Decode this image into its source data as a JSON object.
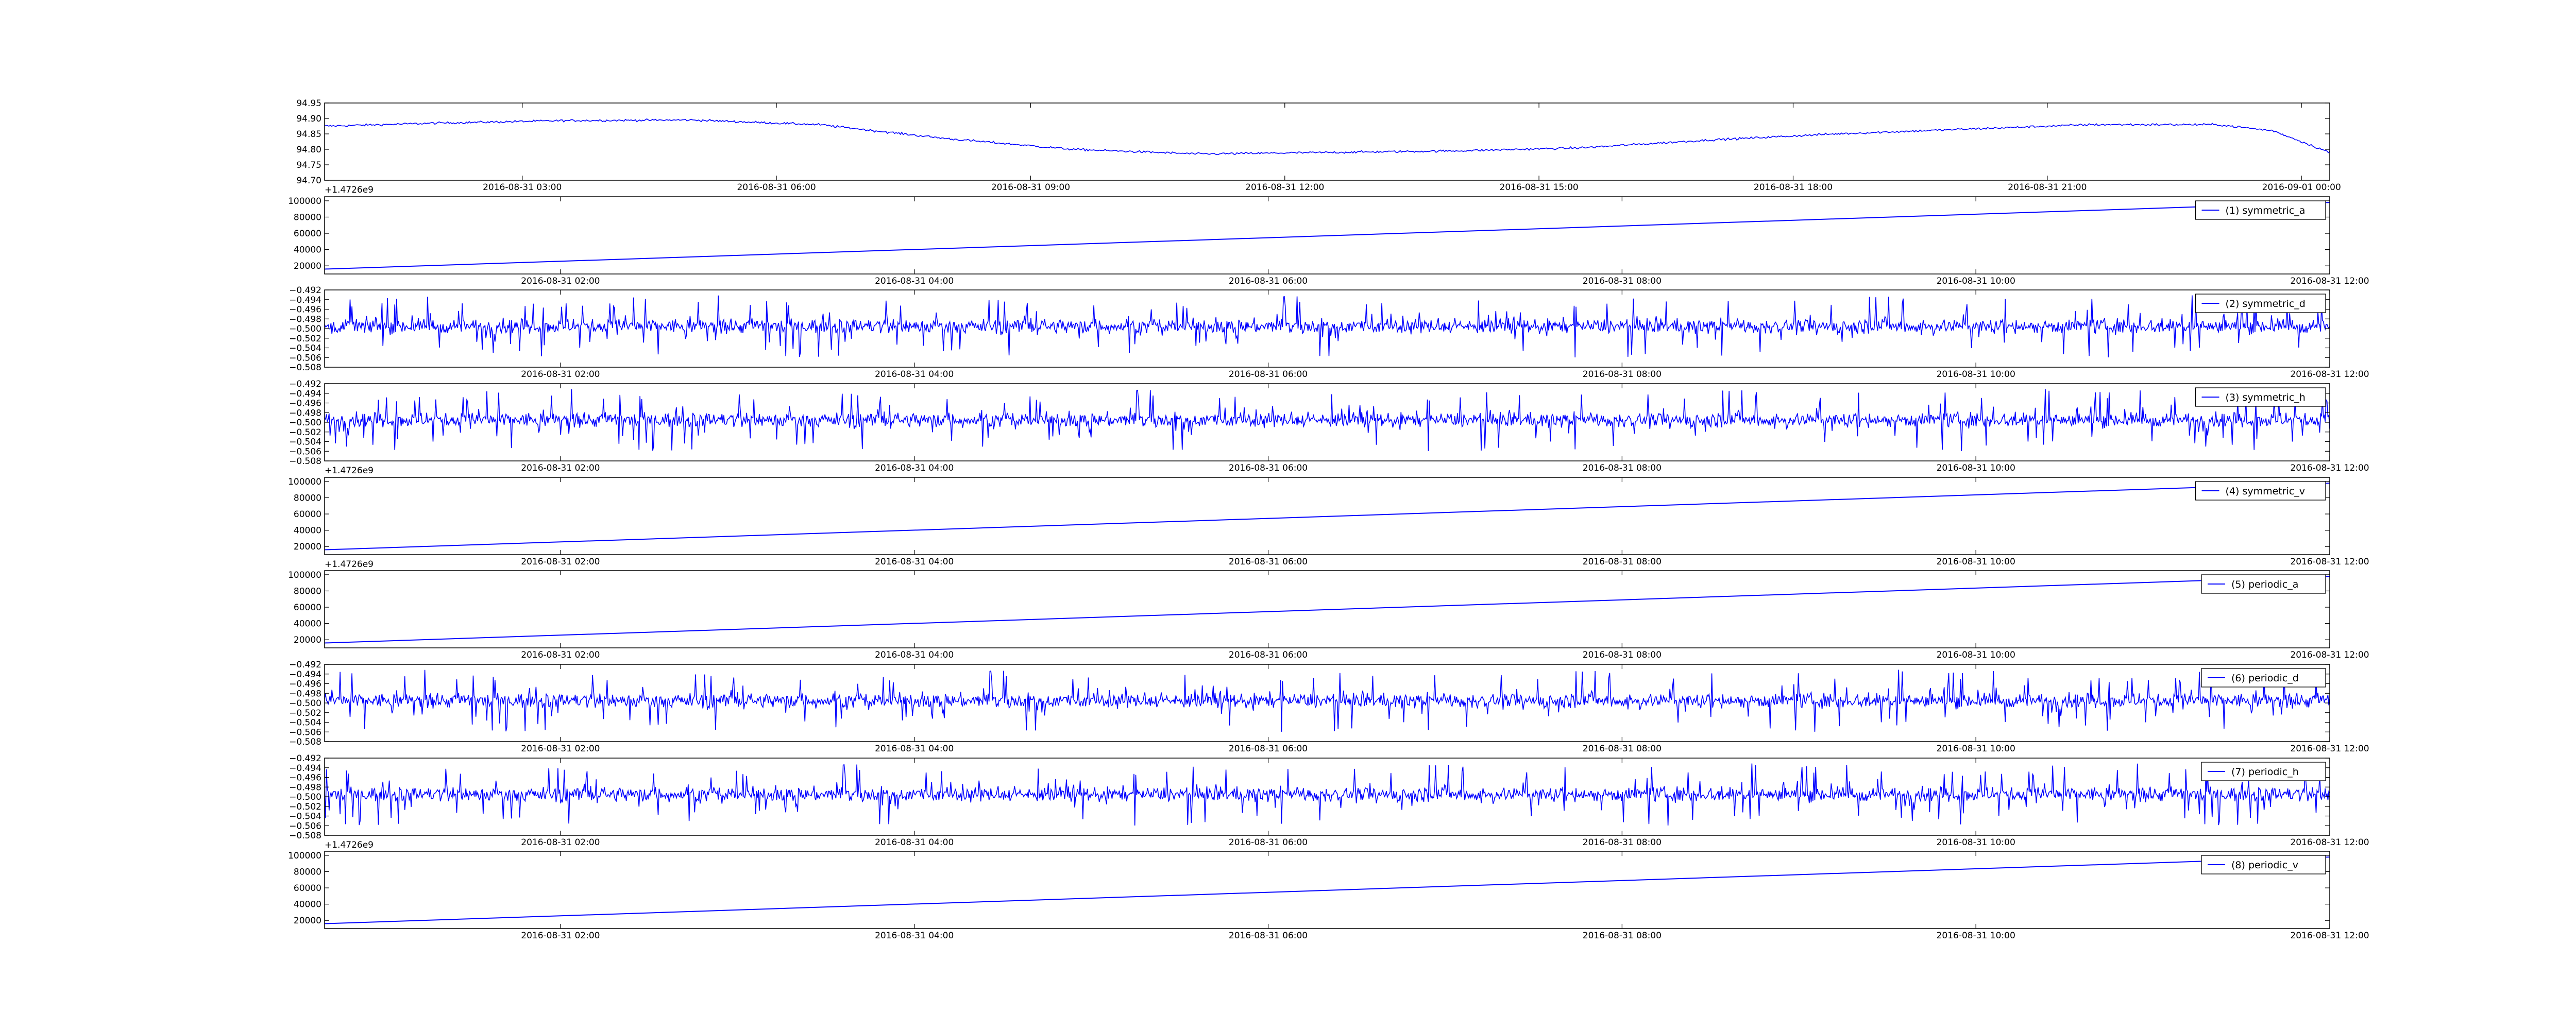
{
  "style": {
    "line_color": "#0000ff",
    "axes_color": "#000000",
    "background": "#ffffff"
  },
  "chart_data": [
    {
      "id": "top",
      "type": "line",
      "signal": "wander",
      "x_range": [
        "2016-08-31 00:40",
        "2016-09-01 00:20"
      ],
      "ylim": [
        94.7,
        94.95
      ],
      "yticks": [
        "94.70",
        "94.75",
        "94.80",
        "94.85",
        "94.90",
        "94.95"
      ],
      "xticks": [
        {
          "at": "2016-08-31 03:00",
          "label": "2016-08-31 03:00"
        },
        {
          "at": "2016-08-31 06:00",
          "label": "2016-08-31 06:00"
        },
        {
          "at": "2016-08-31 09:00",
          "label": "2016-08-31 09:00"
        },
        {
          "at": "2016-08-31 12:00",
          "label": "2016-08-31 12:00"
        },
        {
          "at": "2016-08-31 15:00",
          "label": "2016-08-31 15:00"
        },
        {
          "at": "2016-08-31 18:00",
          "label": "2016-08-31 18:00"
        },
        {
          "at": "2016-08-31 21:00",
          "label": "2016-08-31 21:00"
        },
        {
          "at": "2016-09-01 00:00",
          "label": "2016-09-01 00:00"
        }
      ],
      "offset_label": "+1.4726e9",
      "trend": [
        {
          "x": "2016-08-31 00:40",
          "y": 94.875
        },
        {
          "x": "2016-08-31 02:00",
          "y": 94.885
        },
        {
          "x": "2016-08-31 03:30",
          "y": 94.893
        },
        {
          "x": "2016-08-31 05:00",
          "y": 94.895
        },
        {
          "x": "2016-08-31 06:30",
          "y": 94.88
        },
        {
          "x": "2016-08-31 08:00",
          "y": 94.835
        },
        {
          "x": "2016-08-31 09:30",
          "y": 94.8
        },
        {
          "x": "2016-08-31 11:00",
          "y": 94.785
        },
        {
          "x": "2016-08-31 12:30",
          "y": 94.79
        },
        {
          "x": "2016-08-31 14:00",
          "y": 94.795
        },
        {
          "x": "2016-08-31 15:30",
          "y": 94.805
        },
        {
          "x": "2016-08-31 17:00",
          "y": 94.83
        },
        {
          "x": "2016-08-31 18:30",
          "y": 94.85
        },
        {
          "x": "2016-08-31 20:00",
          "y": 94.865
        },
        {
          "x": "2016-08-31 21:30",
          "y": 94.88
        },
        {
          "x": "2016-08-31 23:00",
          "y": 94.88
        },
        {
          "x": "2016-08-31 23:40",
          "y": 94.86
        },
        {
          "x": "2016-09-01 00:20",
          "y": 94.79
        }
      ]
    },
    {
      "id": "symmetric_a",
      "type": "line",
      "signal": "linear",
      "legend": "(1) symmetric_a",
      "x_range": [
        "2016-08-31 00:40",
        "2016-08-31 12:00"
      ],
      "ylim": [
        10000,
        105000
      ],
      "yticks": [
        "20000",
        "40000",
        "60000",
        "80000",
        "100000"
      ],
      "xticks": [
        {
          "at": "2016-08-31 02:00",
          "label": "2016-08-31 02:00"
        },
        {
          "at": "2016-08-31 04:00",
          "label": "2016-08-31 04:00"
        },
        {
          "at": "2016-08-31 06:00",
          "label": "2016-08-31 06:00"
        },
        {
          "at": "2016-08-31 08:00",
          "label": "2016-08-31 08:00"
        },
        {
          "at": "2016-08-31 10:00",
          "label": "2016-08-31 10:00"
        },
        {
          "at": "2016-08-31 12:00",
          "label": "2016-08-31 12:00"
        }
      ],
      "offset_label": "",
      "trend": [
        {
          "x": "2016-08-31 00:40",
          "y": 16000
        },
        {
          "x": "2016-08-31 12:00",
          "y": 98000
        }
      ]
    },
    {
      "id": "symmetric_d",
      "type": "line",
      "signal": "noise",
      "legend": "(2) symmetric_d",
      "x_range": [
        "2016-08-31 00:40",
        "2016-08-31 12:00"
      ],
      "ylim": [
        -0.508,
        -0.492
      ],
      "yticks": [
        "−0.508",
        "−0.506",
        "−0.504",
        "−0.502",
        "−0.500",
        "−0.498",
        "−0.496",
        "−0.494",
        "−0.492"
      ],
      "xticks": [
        {
          "at": "2016-08-31 02:00",
          "label": "2016-08-31 02:00"
        },
        {
          "at": "2016-08-31 04:00",
          "label": "2016-08-31 04:00"
        },
        {
          "at": "2016-08-31 06:00",
          "label": "2016-08-31 06:00"
        },
        {
          "at": "2016-08-31 08:00",
          "label": "2016-08-31 08:00"
        },
        {
          "at": "2016-08-31 10:00",
          "label": "2016-08-31 10:00"
        },
        {
          "at": "2016-08-31 12:00",
          "label": "2016-08-31 12:00"
        }
      ],
      "offset_label": "",
      "center": -0.4995,
      "amplitude": 0.0065
    },
    {
      "id": "symmetric_h",
      "type": "line",
      "signal": "noise",
      "legend": "(3) symmetric_h",
      "x_range": [
        "2016-08-31 00:40",
        "2016-08-31 12:00"
      ],
      "ylim": [
        -0.508,
        -0.492
      ],
      "yticks": [
        "−0.508",
        "−0.506",
        "−0.504",
        "−0.502",
        "−0.500",
        "−0.498",
        "−0.496",
        "−0.494",
        "−0.492"
      ],
      "xticks": [
        {
          "at": "2016-08-31 02:00",
          "label": "2016-08-31 02:00"
        },
        {
          "at": "2016-08-31 04:00",
          "label": "2016-08-31 04:00"
        },
        {
          "at": "2016-08-31 06:00",
          "label": "2016-08-31 06:00"
        },
        {
          "at": "2016-08-31 08:00",
          "label": "2016-08-31 08:00"
        },
        {
          "at": "2016-08-31 10:00",
          "label": "2016-08-31 10:00"
        },
        {
          "at": "2016-08-31 12:00",
          "label": "2016-08-31 12:00"
        }
      ],
      "offset_label": "+1.4726e9",
      "center": -0.4995,
      "amplitude": 0.0065
    },
    {
      "id": "symmetric_v",
      "type": "line",
      "signal": "linear",
      "legend": "(4) symmetric_v",
      "x_range": [
        "2016-08-31 00:40",
        "2016-08-31 12:00"
      ],
      "ylim": [
        10000,
        105000
      ],
      "yticks": [
        "20000",
        "40000",
        "60000",
        "80000",
        "100000"
      ],
      "xticks": [
        {
          "at": "2016-08-31 02:00",
          "label": "2016-08-31 02:00"
        },
        {
          "at": "2016-08-31 04:00",
          "label": "2016-08-31 04:00"
        },
        {
          "at": "2016-08-31 06:00",
          "label": "2016-08-31 06:00"
        },
        {
          "at": "2016-08-31 08:00",
          "label": "2016-08-31 08:00"
        },
        {
          "at": "2016-08-31 10:00",
          "label": "2016-08-31 10:00"
        },
        {
          "at": "2016-08-31 12:00",
          "label": "2016-08-31 12:00"
        }
      ],
      "offset_label": "+1.4726e9",
      "trend": [
        {
          "x": "2016-08-31 00:40",
          "y": 16000
        },
        {
          "x": "2016-08-31 12:00",
          "y": 98000
        }
      ]
    },
    {
      "id": "periodic_a",
      "type": "line",
      "signal": "linear",
      "legend": "(5) periodic_a",
      "x_range": [
        "2016-08-31 00:40",
        "2016-08-31 12:00"
      ],
      "ylim": [
        10000,
        105000
      ],
      "yticks": [
        "20000",
        "40000",
        "60000",
        "80000",
        "100000"
      ],
      "xticks": [
        {
          "at": "2016-08-31 02:00",
          "label": "2016-08-31 02:00"
        },
        {
          "at": "2016-08-31 04:00",
          "label": "2016-08-31 04:00"
        },
        {
          "at": "2016-08-31 06:00",
          "label": "2016-08-31 06:00"
        },
        {
          "at": "2016-08-31 08:00",
          "label": "2016-08-31 08:00"
        },
        {
          "at": "2016-08-31 10:00",
          "label": "2016-08-31 10:00"
        },
        {
          "at": "2016-08-31 12:00",
          "label": "2016-08-31 12:00"
        }
      ],
      "offset_label": "",
      "trend": [
        {
          "x": "2016-08-31 00:40",
          "y": 16000
        },
        {
          "x": "2016-08-31 12:00",
          "y": 98000
        }
      ]
    },
    {
      "id": "periodic_d",
      "type": "line",
      "signal": "noise",
      "legend": "(6) periodic_d",
      "x_range": [
        "2016-08-31 00:40",
        "2016-08-31 12:00"
      ],
      "ylim": [
        -0.508,
        -0.492
      ],
      "yticks": [
        "−0.508",
        "−0.506",
        "−0.504",
        "−0.502",
        "−0.500",
        "−0.498",
        "−0.496",
        "−0.494",
        "−0.492"
      ],
      "xticks": [
        {
          "at": "2016-08-31 02:00",
          "label": "2016-08-31 02:00"
        },
        {
          "at": "2016-08-31 04:00",
          "label": "2016-08-31 04:00"
        },
        {
          "at": "2016-08-31 06:00",
          "label": "2016-08-31 06:00"
        },
        {
          "at": "2016-08-31 08:00",
          "label": "2016-08-31 08:00"
        },
        {
          "at": "2016-08-31 10:00",
          "label": "2016-08-31 10:00"
        },
        {
          "at": "2016-08-31 12:00",
          "label": "2016-08-31 12:00"
        }
      ],
      "offset_label": "",
      "center": -0.4995,
      "amplitude": 0.0065
    },
    {
      "id": "periodic_h",
      "type": "line",
      "signal": "noise",
      "legend": "(7) periodic_h",
      "x_range": [
        "2016-08-31 00:40",
        "2016-08-31 12:00"
      ],
      "ylim": [
        -0.508,
        -0.492
      ],
      "yticks": [
        "−0.508",
        "−0.506",
        "−0.504",
        "−0.502",
        "−0.500",
        "−0.498",
        "−0.496",
        "−0.494",
        "−0.492"
      ],
      "xticks": [
        {
          "at": "2016-08-31 02:00",
          "label": "2016-08-31 02:00"
        },
        {
          "at": "2016-08-31 04:00",
          "label": "2016-08-31 04:00"
        },
        {
          "at": "2016-08-31 06:00",
          "label": "2016-08-31 06:00"
        },
        {
          "at": "2016-08-31 08:00",
          "label": "2016-08-31 08:00"
        },
        {
          "at": "2016-08-31 10:00",
          "label": "2016-08-31 10:00"
        },
        {
          "at": "2016-08-31 12:00",
          "label": "2016-08-31 12:00"
        }
      ],
      "offset_label": "+1.4726e9",
      "center": -0.4995,
      "amplitude": 0.0065
    },
    {
      "id": "periodic_v",
      "type": "line",
      "signal": "linear",
      "legend": "(8) periodic_v",
      "x_range": [
        "2016-08-31 00:40",
        "2016-08-31 12:00"
      ],
      "ylim": [
        10000,
        105000
      ],
      "yticks": [
        "20000",
        "40000",
        "60000",
        "80000",
        "100000"
      ],
      "xticks": [
        {
          "at": "2016-08-31 02:00",
          "label": "2016-08-31 02:00"
        },
        {
          "at": "2016-08-31 04:00",
          "label": "2016-08-31 04:00"
        },
        {
          "at": "2016-08-31 06:00",
          "label": "2016-08-31 06:00"
        },
        {
          "at": "2016-08-31 08:00",
          "label": "2016-08-31 08:00"
        },
        {
          "at": "2016-08-31 10:00",
          "label": "2016-08-31 10:00"
        },
        {
          "at": "2016-08-31 12:00",
          "label": "2016-08-31 12:00"
        }
      ],
      "offset_label": "",
      "trend": [
        {
          "x": "2016-08-31 00:40",
          "y": 16000
        },
        {
          "x": "2016-08-31 12:00",
          "y": 98000
        }
      ]
    }
  ]
}
